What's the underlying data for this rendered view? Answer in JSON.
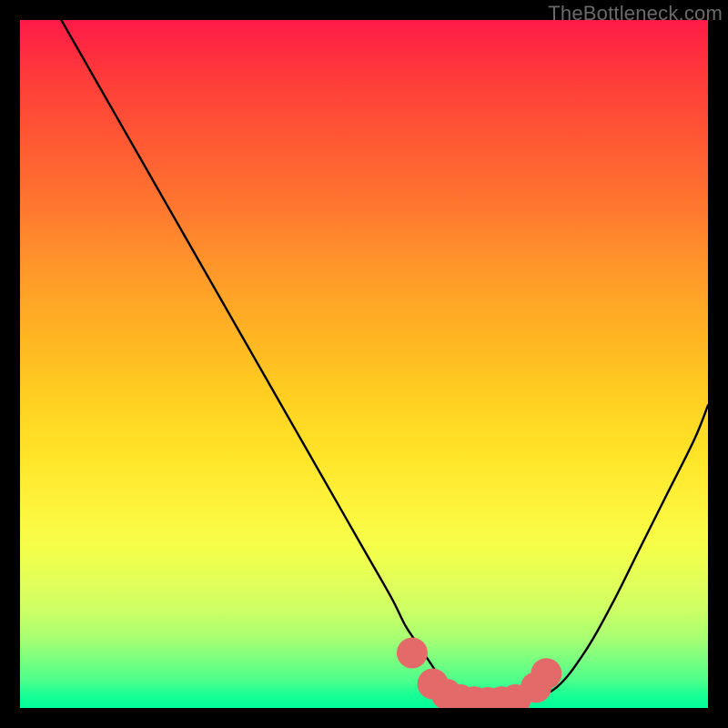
{
  "watermark": "TheBottleneck.com",
  "colors": {
    "frame_border": "#000000",
    "curve": "#000000",
    "marker": "#e46a6a",
    "gradient_top": "#ff1a47",
    "gradient_bottom": "#00ff99"
  },
  "chart_data": {
    "type": "line",
    "title": "",
    "xlabel": "",
    "ylabel": "",
    "xlim": [
      0,
      100
    ],
    "ylim": [
      0,
      100
    ],
    "grid": false,
    "legend": false,
    "series": [
      {
        "name": "bottleneck-curve",
        "x": [
          6,
          10,
          14,
          18,
          22,
          26,
          30,
          34,
          38,
          42,
          46,
          50,
          54,
          56,
          58,
          60,
          62,
          64,
          66,
          68,
          70,
          72,
          74,
          78,
          82,
          86,
          90,
          94,
          98,
          100
        ],
        "y": [
          100,
          93,
          86,
          79,
          72,
          65,
          58,
          51,
          44,
          37,
          30,
          23,
          16,
          12,
          9,
          6,
          3,
          1.5,
          0.8,
          0.5,
          0.5,
          0.6,
          1.2,
          3,
          8,
          15,
          23,
          31,
          39,
          44
        ]
      }
    ],
    "flat_region": {
      "x_start": 56,
      "x_end": 76,
      "y": 1
    },
    "markers": [
      {
        "name": "flat-left",
        "x": 57,
        "y": 8,
        "r": 2.3
      },
      {
        "name": "flat-1",
        "x": 60,
        "y": 3.5,
        "r": 2.3
      },
      {
        "name": "flat-2",
        "x": 62,
        "y": 2,
        "r": 2.3
      },
      {
        "name": "flat-3",
        "x": 64,
        "y": 1.2,
        "r": 2.3
      },
      {
        "name": "flat-4",
        "x": 66,
        "y": 0.9,
        "r": 2.3
      },
      {
        "name": "flat-5",
        "x": 68,
        "y": 0.8,
        "r": 2.3
      },
      {
        "name": "flat-6",
        "x": 70,
        "y": 0.9,
        "r": 2.3
      },
      {
        "name": "flat-7",
        "x": 72,
        "y": 1.2,
        "r": 2.3
      },
      {
        "name": "flat-right",
        "x": 75,
        "y": 3,
        "r": 2.3
      },
      {
        "name": "flat-right2",
        "x": 76.5,
        "y": 5,
        "r": 2.3
      }
    ]
  }
}
